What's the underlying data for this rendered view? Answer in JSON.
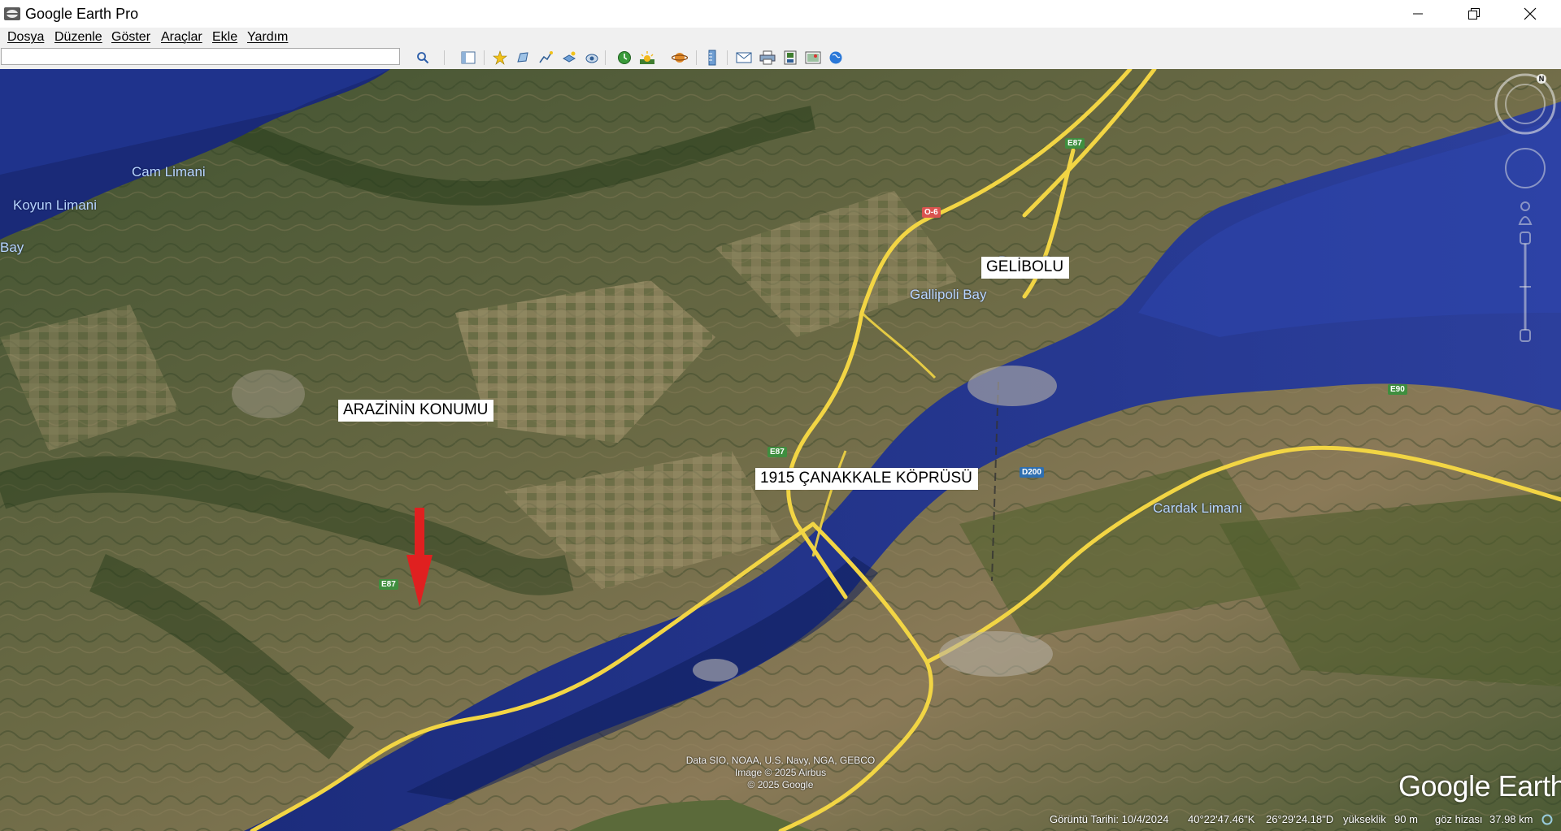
{
  "window": {
    "title": "Google Earth Pro",
    "controls": [
      "minimize",
      "maximize",
      "close"
    ]
  },
  "menu": {
    "items": [
      {
        "label": "Dosya"
      },
      {
        "label": "Düzenle"
      },
      {
        "label": "Göster"
      },
      {
        "label": "Araçlar"
      },
      {
        "label": "Ekle"
      },
      {
        "label": "Yardım"
      }
    ]
  },
  "toolbar": {
    "search_value": "",
    "search_placeholder": "",
    "buttons": [
      "search-icon",
      "sidebar-toggle-icon",
      "add-placemark-icon",
      "add-polygon-icon",
      "add-path-icon",
      "add-image-overlay-icon",
      "record-tour-icon",
      "historical-imagery-icon",
      "sunlight-icon",
      "switch-planet-icon",
      "ruler-icon",
      "email-icon",
      "print-icon",
      "save-image-icon",
      "view-in-maps-icon",
      "earth-gallery-icon"
    ]
  },
  "map": {
    "places": {
      "cam_limani": "Cam Limani",
      "koyun_limani": "Koyun Limani",
      "bay": "Bay",
      "doruk_bay": "Do    me Bay",
      "gallipoli_bay": "Gallipoli Bay",
      "cardak_limani": "Cardak Limani"
    },
    "callouts": {
      "gelibolu": "GELİBOLU",
      "arazinin_konumu": "ARAZİNİN KONUMU",
      "canakkale_koprusu": "1915 ÇANAKKALE KÖPRÜSÜ"
    },
    "road_shields": {
      "e87_top": "E87",
      "o6": "O-6",
      "e87_mid": "E87",
      "e87_bottom": "E87",
      "d200": "D200",
      "e90": "E90"
    },
    "attribution": {
      "line1": "Data SIO, NOAA, U.S. Navy, NGA, GEBCO",
      "line2": "Image © 2025 Airbus",
      "line3": "© 2025 Google"
    },
    "watermark": "Google Earth",
    "colors": {
      "water": "#1b2f86",
      "water_deep": "#10225e",
      "land": "#4a5a34",
      "road": "#f5d94a",
      "arrow": "#e02020"
    }
  },
  "statusbar": {
    "imagery_date": "Görüntü Tarihi: 10/4/2024",
    "latitude": "40°22'47.46\"K",
    "longitude": "26°29'24.18\"D",
    "elevation_label": "yükseklik",
    "elevation_value": "90 m",
    "eye_alt_label": "göz hizası",
    "eye_alt_value": "37.98 km"
  }
}
